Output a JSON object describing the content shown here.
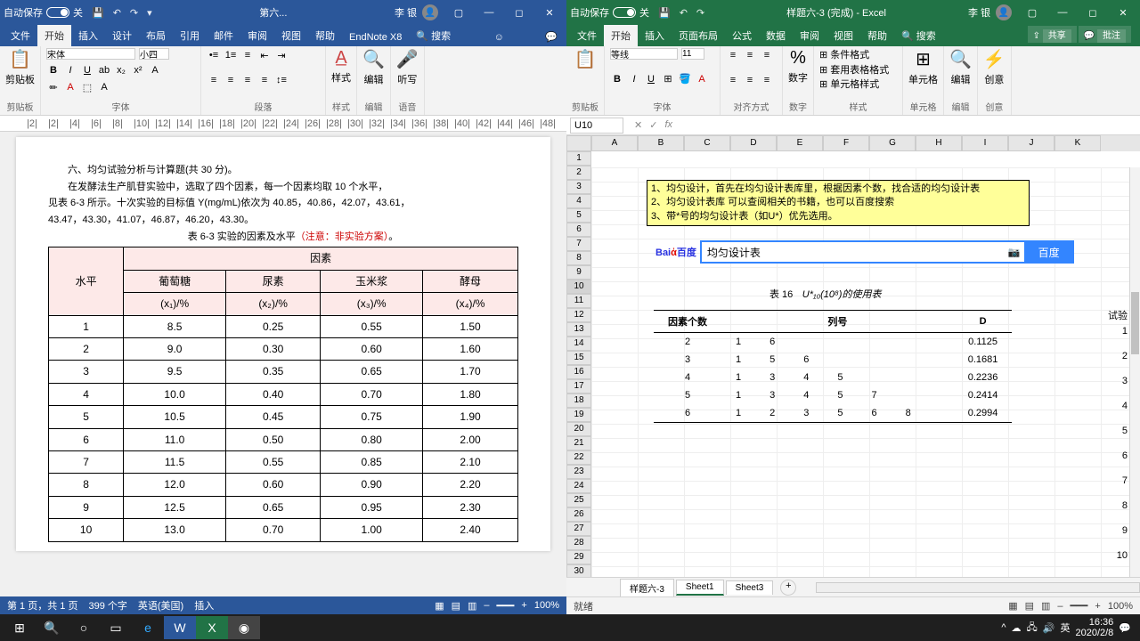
{
  "word": {
    "autosave_label": "自动保存",
    "autosave_state": "关",
    "doc_title": "第六...",
    "user_name": "李 银",
    "tabs": [
      "文件",
      "开始",
      "插入",
      "设计",
      "布局",
      "引用",
      "邮件",
      "审阅",
      "视图",
      "帮助",
      "EndNote X8"
    ],
    "search_placeholder": "搜索",
    "groups": {
      "clipboard": "剪贴板",
      "font": "字体",
      "paragraph": "段落",
      "styles": "样式",
      "editing": "编辑",
      "voice": "语音"
    },
    "font_name": "宋体",
    "font_size": "小四",
    "styles_btn": "样式",
    "editing_btn": "编辑",
    "dictate_btn": "听写",
    "status": {
      "page": "第 1 页，共 1 页",
      "words": "399 个字",
      "lang": "英语(美国)",
      "mode": "插入",
      "zoom": "100%"
    },
    "content": {
      "line1": "六、均匀试验分析与计算题(共 30 分)。",
      "line2": "在发酵法生产肌苷实验中，选取了四个因素，每一个因素均取 10 个水平，",
      "line3": "见表 6-3 所示。十次实验的目标值 Y(mg/mL)依次为 40.85，40.86，42.07，43.61，",
      "line4": "43.47，43.30，41.07，46.87，46.20，43.30。",
      "caption_a": "表 6-3  实验的因素及水平",
      "caption_b": "（注意：非实验方案）",
      "hdr_level": "水平",
      "hdr_factor": "因素",
      "factors": [
        "葡萄糖",
        "尿素",
        "玉米浆",
        "酵母"
      ],
      "units": [
        "(x₁)/%",
        "(x₂)/%",
        "(x₃)/%",
        "(x₄)/%"
      ],
      "rows": [
        [
          "1",
          "8.5",
          "0.25",
          "0.55",
          "1.50"
        ],
        [
          "2",
          "9.0",
          "0.30",
          "0.60",
          "1.60"
        ],
        [
          "3",
          "9.5",
          "0.35",
          "0.65",
          "1.70"
        ],
        [
          "4",
          "10.0",
          "0.40",
          "0.70",
          "1.80"
        ],
        [
          "5",
          "10.5",
          "0.45",
          "0.75",
          "1.90"
        ],
        [
          "6",
          "11.0",
          "0.50",
          "0.80",
          "2.00"
        ],
        [
          "7",
          "11.5",
          "0.55",
          "0.85",
          "2.10"
        ],
        [
          "8",
          "12.0",
          "0.60",
          "0.90",
          "2.20"
        ],
        [
          "9",
          "12.5",
          "0.65",
          "0.95",
          "2.30"
        ],
        [
          "10",
          "13.0",
          "0.70",
          "1.00",
          "2.40"
        ]
      ]
    }
  },
  "excel": {
    "autosave_label": "自动保存",
    "autosave_state": "关",
    "doc_title": "样题六-3 (完成) - Excel",
    "user_name": "李 银",
    "tabs": [
      "文件",
      "开始",
      "插入",
      "页面布局",
      "公式",
      "数据",
      "审阅",
      "视图",
      "帮助"
    ],
    "search_placeholder": "搜索",
    "share": "共享",
    "comments": "批注",
    "groups": {
      "clipboard": "剪贴板",
      "font": "字体",
      "align": "对齐方式",
      "number": "数字",
      "styles": "样式",
      "cells": "单元格",
      "editing": "编辑",
      "ideas": "创意"
    },
    "font_name": "等线",
    "font_size": "11",
    "styles_items": [
      "条件格式",
      "套用表格格式",
      "单元格样式"
    ],
    "cells_btn": "单元格",
    "editing_btn": "编辑",
    "ideas_btn": "创意",
    "number_btn": "数字",
    "name_box": "U10",
    "cols": [
      "A",
      "B",
      "C",
      "D",
      "E",
      "F",
      "G",
      "H",
      "I",
      "J",
      "K"
    ],
    "notes": [
      "1、均匀设计，首先在均匀设计表库里，根据因素个数，找合适的均匀设计表",
      "2、均匀设计表库 可以查阅相关的书籍，也可以百度搜索",
      "3、带*号的均匀设计表（如U*）优先选用。"
    ],
    "search_value": "均匀设计表",
    "search_btn": "百度",
    "u_title_a": "表 16",
    "u_title_b": "U*₁₀(10⁸)的使用表",
    "u_hdr": [
      "因素个数",
      "列号",
      "D"
    ],
    "rt_hdr": "试验",
    "u_rows": [
      {
        "n": "2",
        "cols": [
          "1",
          "6",
          "",
          "",
          "",
          "",
          ""
        ],
        "d": "0.1125"
      },
      {
        "n": "3",
        "cols": [
          "1",
          "5",
          "6",
          "",
          "",
          "",
          ""
        ],
        "d": "0.1681"
      },
      {
        "n": "4",
        "cols": [
          "1",
          "3",
          "4",
          "5",
          "",
          "",
          ""
        ],
        "d": "0.2236"
      },
      {
        "n": "5",
        "cols": [
          "1",
          "3",
          "4",
          "5",
          "7",
          "",
          ""
        ],
        "d": "0.2414"
      },
      {
        "n": "6",
        "cols": [
          "1",
          "2",
          "3",
          "5",
          "6",
          "8",
          ""
        ],
        "d": "0.2994"
      }
    ],
    "rt_nums": [
      "1",
      "2",
      "3",
      "4",
      "5",
      "6",
      "7",
      "8",
      "9",
      "10"
    ],
    "sheets": [
      "样题六-3",
      "Sheet1",
      "Sheet3"
    ],
    "status": {
      "ready": "就绪",
      "zoom": "100%"
    }
  },
  "taskbar": {
    "time": "16:36",
    "date": "2020/2/8"
  },
  "chart_data": {
    "type": "table",
    "title": "表 16  U*10(10^8)的使用表",
    "columns": [
      "因素个数",
      "列号",
      "D"
    ],
    "rows": [
      [
        2,
        [
          1,
          6
        ],
        0.1125
      ],
      [
        3,
        [
          1,
          5,
          6
        ],
        0.1681
      ],
      [
        4,
        [
          1,
          3,
          4,
          5
        ],
        0.2236
      ],
      [
        5,
        [
          1,
          3,
          4,
          5,
          7
        ],
        0.2414
      ],
      [
        6,
        [
          1,
          2,
          3,
          5,
          6,
          8
        ],
        0.2994
      ]
    ]
  }
}
